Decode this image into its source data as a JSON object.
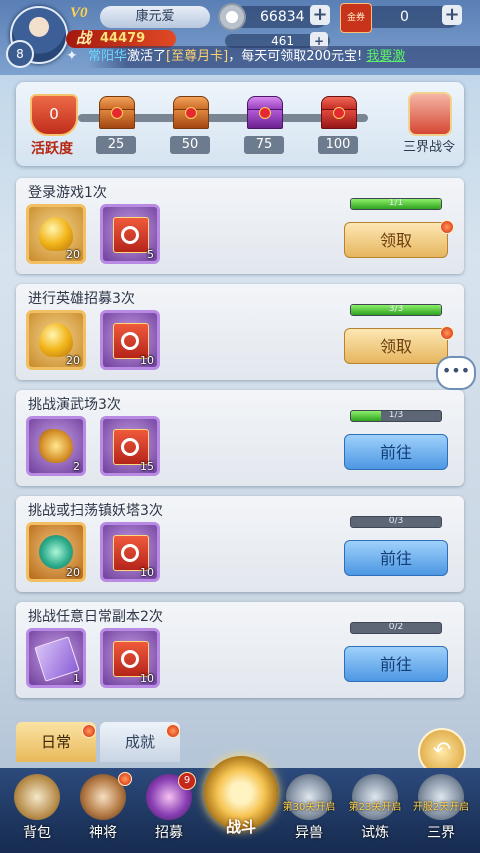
{
  "player": {
    "level": "8",
    "vip": "V0",
    "name": "康元爱",
    "power_label": "战",
    "power": "44479"
  },
  "resources": {
    "silver": "66834",
    "voucher_label": "金券",
    "voucher": "0",
    "secondary": "461"
  },
  "marquee": {
    "name": "常阳华",
    "pre": "激活了",
    "card": "[至尊月卡]",
    "post": "，每天可领取200元宝!",
    "action": "我要激"
  },
  "activity": {
    "current": "0",
    "label": "活跃度",
    "milestones": [
      "25",
      "50",
      "75",
      "100"
    ],
    "pass_label": "三界战令"
  },
  "tasks": [
    {
      "title": "登录游戏1次",
      "rewards": [
        {
          "count": "20"
        },
        {
          "count": "5"
        }
      ],
      "progress_text": "1/1",
      "progress": 1.0,
      "button": "领取"
    },
    {
      "title": "进行英雄招募3次",
      "rewards": [
        {
          "count": "20"
        },
        {
          "count": "10"
        }
      ],
      "progress_text": "3/3",
      "progress": 1.0,
      "button": "领取"
    },
    {
      "title": "挑战演武场3次",
      "rewards": [
        {
          "count": "2"
        },
        {
          "count": "15"
        }
      ],
      "progress_text": "1/3",
      "progress": 0.33,
      "button": "前往"
    },
    {
      "title": "挑战或扫荡镇妖塔3次",
      "rewards": [
        {
          "count": "20"
        },
        {
          "count": "10"
        }
      ],
      "progress_text": "0/3",
      "progress": 0.0,
      "button": "前往"
    },
    {
      "title": "挑战任意日常副本2次",
      "rewards": [
        {
          "count": "1"
        },
        {
          "count": "10"
        }
      ],
      "progress_text": "0/2",
      "progress": 0.0,
      "button": "前往"
    }
  ],
  "tabs": {
    "daily": "日常",
    "achievement": "成就"
  },
  "nav": {
    "bag": "背包",
    "general": "神将",
    "recruit": "招募",
    "recruit_badge": "9",
    "battle": "战斗",
    "beast": "异兽",
    "beast_lock": "第30关开启",
    "trial": "试炼",
    "trial_lock": "第23关开启",
    "realm": "三界",
    "realm_lock": "开服2天开启"
  },
  "colors": {
    "accent_red": "#c12d1c",
    "claim_gold": "#e6b65f",
    "go_blue": "#4d97e3",
    "progress_green": "#2fa21f"
  }
}
